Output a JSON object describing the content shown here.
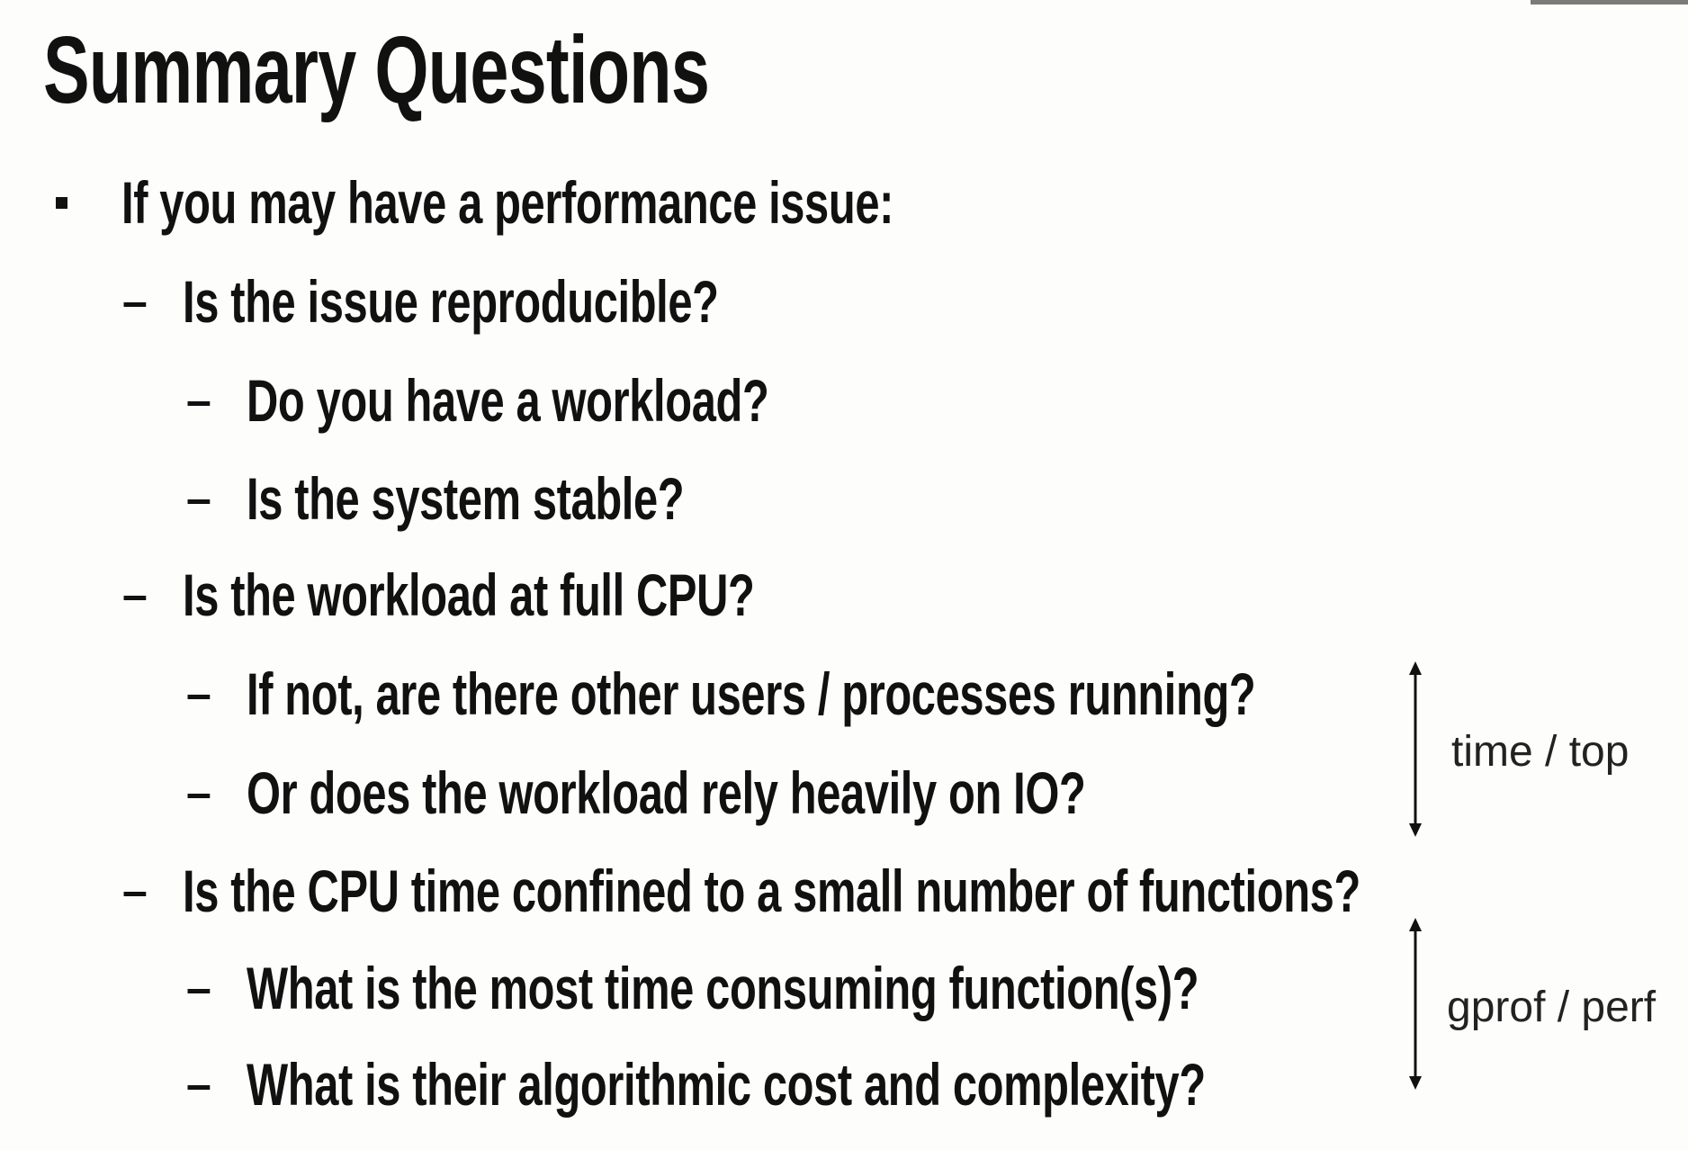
{
  "slide": {
    "title": "Summary Questions",
    "items": [
      {
        "level": 0,
        "marker": "square",
        "text": "If you may have a performance issue:"
      },
      {
        "level": 1,
        "marker": "–",
        "text": "Is the issue reproducible?"
      },
      {
        "level": 2,
        "marker": "–",
        "text": "Do you have a workload?"
      },
      {
        "level": 2,
        "marker": "–",
        "text": "Is the system stable?"
      },
      {
        "level": 1,
        "marker": "–",
        "text": "Is the workload at full CPU?"
      },
      {
        "level": 2,
        "marker": "–",
        "text": "If not, are there other users / processes running?"
      },
      {
        "level": 2,
        "marker": "–",
        "text": "Or does the workload rely heavily on IO?"
      },
      {
        "level": 1,
        "marker": "–",
        "text": "Is the CPU time confined to a small number of functions?"
      },
      {
        "level": 2,
        "marker": "–",
        "text": "What is the most time consuming function(s)?"
      },
      {
        "level": 2,
        "marker": "–",
        "text": "What is their algorithmic cost and complexity?"
      }
    ],
    "annotations": [
      {
        "label": "time / top",
        "icon": "double-arrow-vertical-icon"
      },
      {
        "label": "gprof / perf",
        "icon": "double-arrow-vertical-icon"
      }
    ]
  }
}
